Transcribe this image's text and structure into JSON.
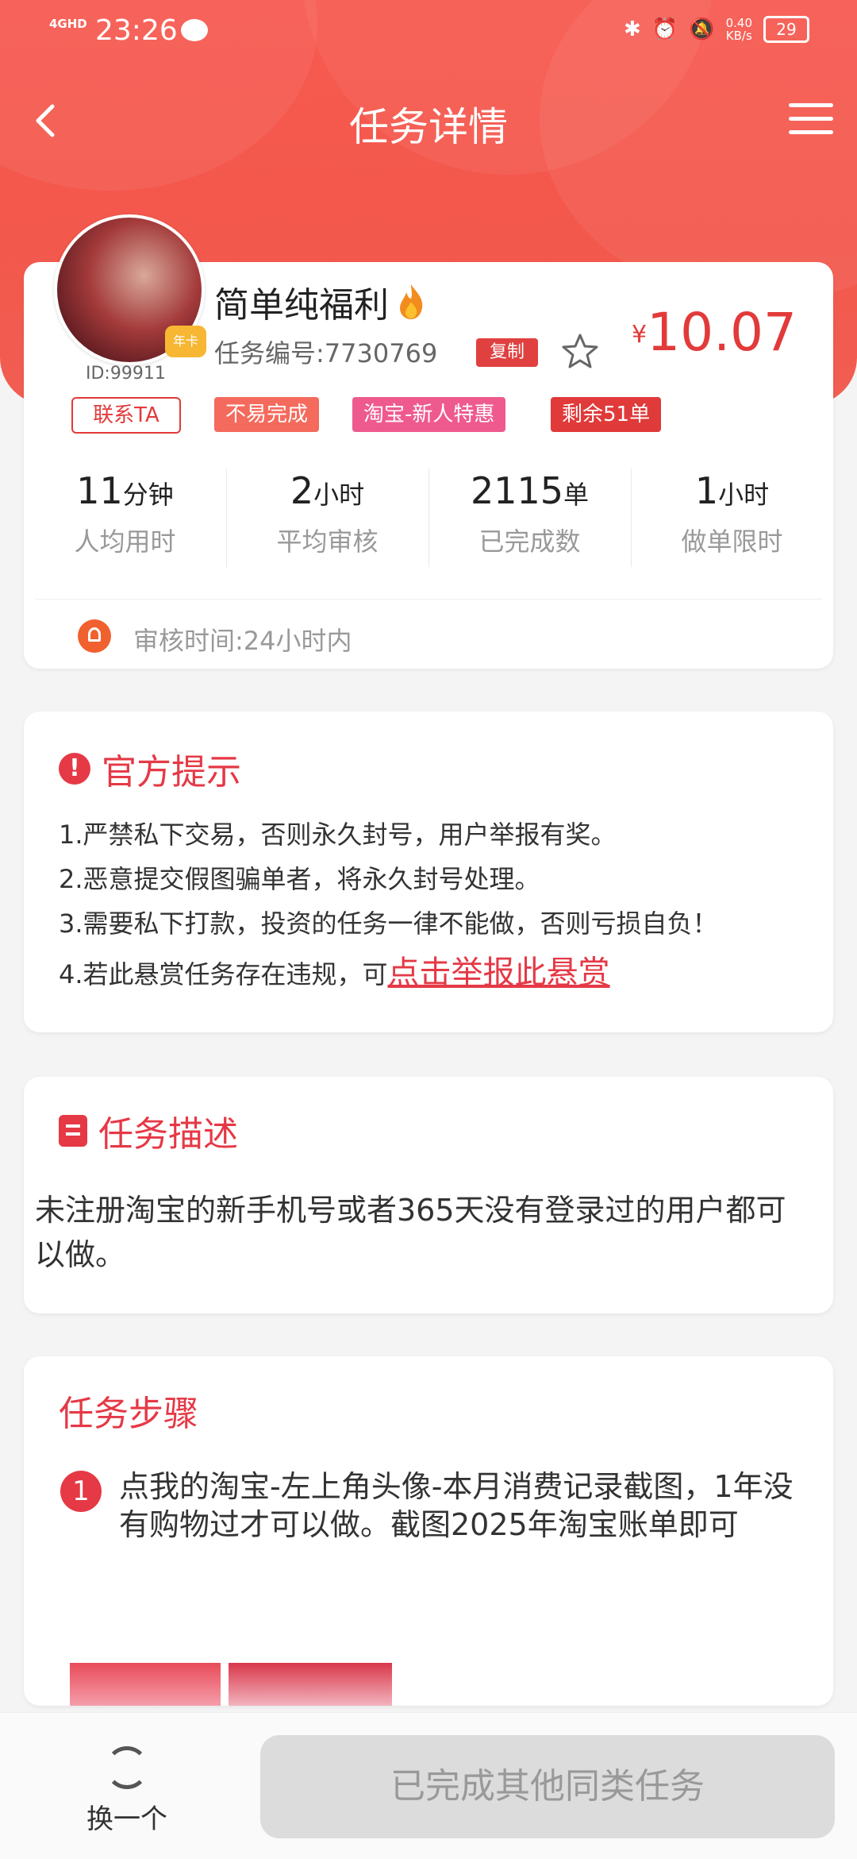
{
  "status_bar": {
    "network": "4GHD",
    "time": "23:26",
    "speed_value": "0.40",
    "speed_unit": "KB/s",
    "battery": "29"
  },
  "nav": {
    "title": "任务详情"
  },
  "task": {
    "name": "简单纯福利",
    "task_no": "任务编号:7730769",
    "copy_label": "复制",
    "price_currency": "¥",
    "price": "10.07",
    "uid": "ID:99911",
    "avatar_badge": "年卡",
    "contact_label": "联系TA",
    "tags": [
      "不易完成",
      "淘宝-新人特惠",
      "剩余51单"
    ]
  },
  "stats": [
    {
      "value": "11",
      "unit": "分钟",
      "label": "人均用时"
    },
    {
      "value": "2",
      "unit": "小时",
      "label": "平均审核"
    },
    {
      "value": "2115",
      "unit": "单",
      "label": "已完成数"
    },
    {
      "value": "1",
      "unit": "小时",
      "label": "做单限时"
    }
  ],
  "review_time": "审核时间:24小时内",
  "notice": {
    "title": "官方提示",
    "lines": [
      "1.严禁私下交易，否则永久封号，用户举报有奖。",
      "2.恶意提交假图骗单者，将永久封号处理。",
      "3.需要私下打款，投资的任务一律不能做，否则亏损自负！",
      "4.若此悬赏任务存在违规，可"
    ],
    "report_link": "点击举报此悬赏"
  },
  "description": {
    "title": "任务描述",
    "text": "未注册淘宝的新手机号或者365天没有登录过的用户都可以做。"
  },
  "steps": {
    "title": "任务步骤",
    "items": [
      {
        "num": "1",
        "text": "点我的淘宝-左上角头像-本月消费记录截图，1年没有购物过才可以做。截图2025年淘宝账单即可"
      }
    ]
  },
  "bottom": {
    "refresh_label": "换一个",
    "done_label": "已完成其他同类任务"
  },
  "colors": {
    "header": "#f75a50",
    "accent": "#e53946",
    "price": "#e23a3a"
  }
}
